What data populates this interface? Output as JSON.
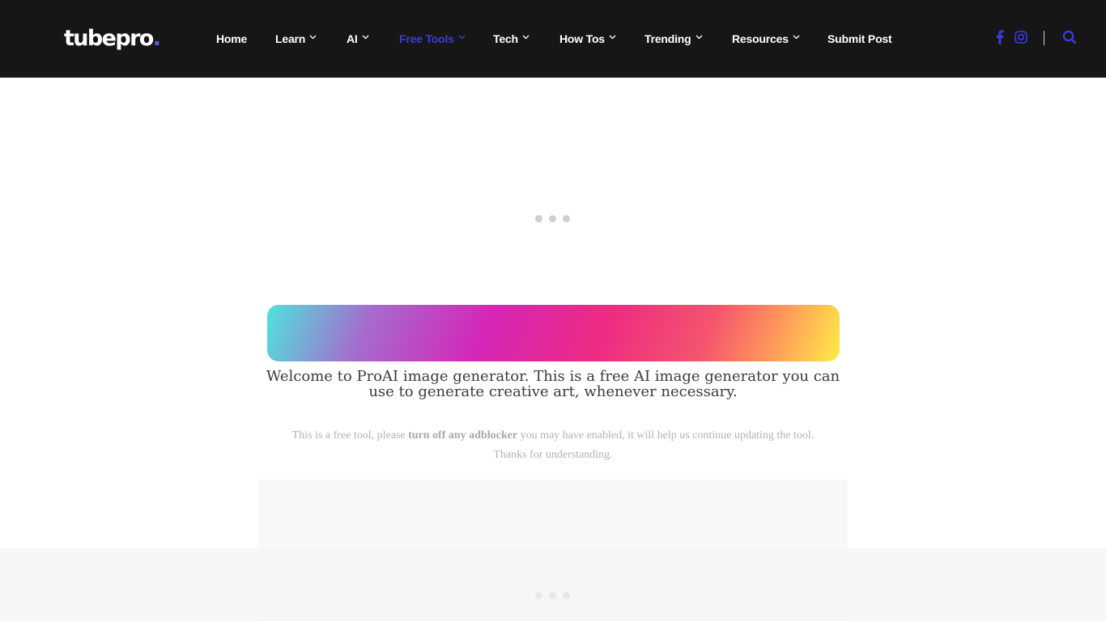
{
  "logo": {
    "text": "tubepro",
    "dot": "."
  },
  "nav": {
    "items": [
      {
        "label": "Home",
        "dropdown": false,
        "active": false
      },
      {
        "label": "Learn",
        "dropdown": true,
        "active": false
      },
      {
        "label": "AI",
        "dropdown": true,
        "active": false
      },
      {
        "label": "Free Tools",
        "dropdown": true,
        "active": true
      },
      {
        "label": "Tech",
        "dropdown": true,
        "active": false
      },
      {
        "label": "How Tos",
        "dropdown": true,
        "active": false
      },
      {
        "label": "Trending",
        "dropdown": true,
        "active": false
      },
      {
        "label": "Resources",
        "dropdown": true,
        "active": false
      },
      {
        "label": "Submit Post",
        "dropdown": false,
        "active": false
      }
    ]
  },
  "header_icons": [
    "facebook-icon",
    "instagram-icon",
    "search-icon"
  ],
  "colors": {
    "header_bg": "#161616",
    "accent": "#3d3ae0",
    "logo_dot": "#5b5ff0"
  },
  "content": {
    "welcome": "Welcome to ProAI image generator. This is a free AI image generator you can use to generate creative art, whenever necessary.",
    "notice_before": "This is a free tool, please ",
    "notice_bold": "turn off any adblocker",
    "notice_after": " you may have enabled, it will help us continue updating the tool.",
    "notice_line2": "Thanks for understanding."
  }
}
